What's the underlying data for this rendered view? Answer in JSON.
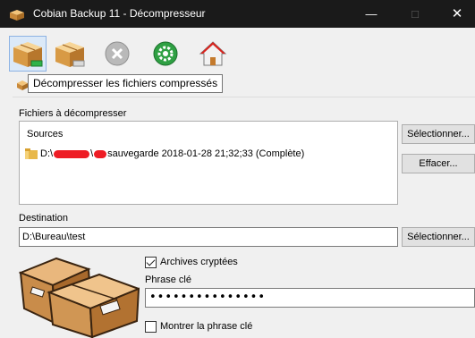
{
  "window": {
    "title": "Cobian Backup 11 - Décompresseur",
    "minimize_glyph": "—",
    "maximize_glyph": "□",
    "close_glyph": "✕"
  },
  "toolbar": {
    "buttons": [
      {
        "name": "decompress-button",
        "icon": "box-green-arrow-icon"
      },
      {
        "name": "decompress-to-button",
        "icon": "box-gray-icon"
      },
      {
        "name": "cancel-button",
        "icon": "cancel-circle-icon"
      },
      {
        "name": "settings-button",
        "icon": "gear-icon"
      },
      {
        "name": "home-button",
        "icon": "house-icon"
      }
    ],
    "tooltip": "Décompresser les fichiers compressés"
  },
  "files_section": {
    "label": "Fichiers à décompresser",
    "list_header": "Sources",
    "row_prefix": "D:\\",
    "row_mid": "\\",
    "row_suffix": "sauvegarde 2018-01-28 21;32;33 (Complète)",
    "select_button": "Sélectionner...",
    "clear_button": "Effacer..."
  },
  "destination": {
    "label": "Destination",
    "value": "D:\\Bureau\\test",
    "select_button": "Sélectionner..."
  },
  "options": {
    "encrypted_label": "Archives cryptées",
    "encrypted_checked": true,
    "passphrase_label": "Phrase clé",
    "passphrase_value": "•••••••••••••••",
    "show_passphrase_label": "Montrer la phrase clé",
    "show_passphrase_checked": false
  },
  "colors": {
    "titlebar": "#1a1a1a",
    "redaction": "#ee1c24",
    "window_bg": "#f0f0f0"
  }
}
